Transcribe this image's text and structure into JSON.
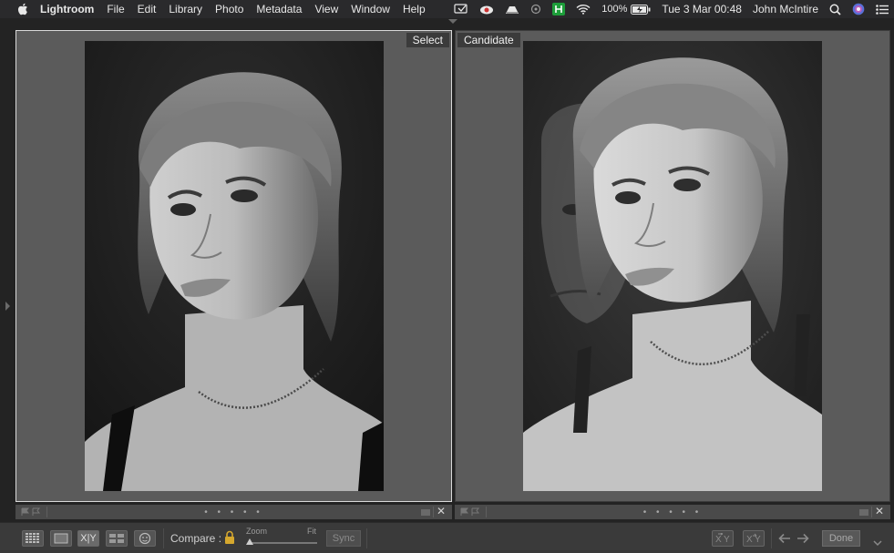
{
  "menubar": {
    "app_name": "Lightroom",
    "menus": [
      "File",
      "Edit",
      "Library",
      "Photo",
      "Metadata",
      "View",
      "Window",
      "Help"
    ],
    "battery": "100%",
    "clock": "Tue 3 Mar  00:48",
    "user": "John McIntire"
  },
  "compare": {
    "select_label": "Select",
    "candidate_label": "Candidate",
    "footer_dots": "• • • • •"
  },
  "toolbar": {
    "compare_label": "Compare :",
    "zoom_label": "Zoom",
    "fit_label": "Fit",
    "sync_label": "Sync",
    "done_label": "Done",
    "xy_label": "X|Y"
  },
  "colors": {
    "pane_bg": "#5b5b5b",
    "toolbar_bg": "#3a3a3a",
    "menubar_bg": "#2a2a2c"
  }
}
